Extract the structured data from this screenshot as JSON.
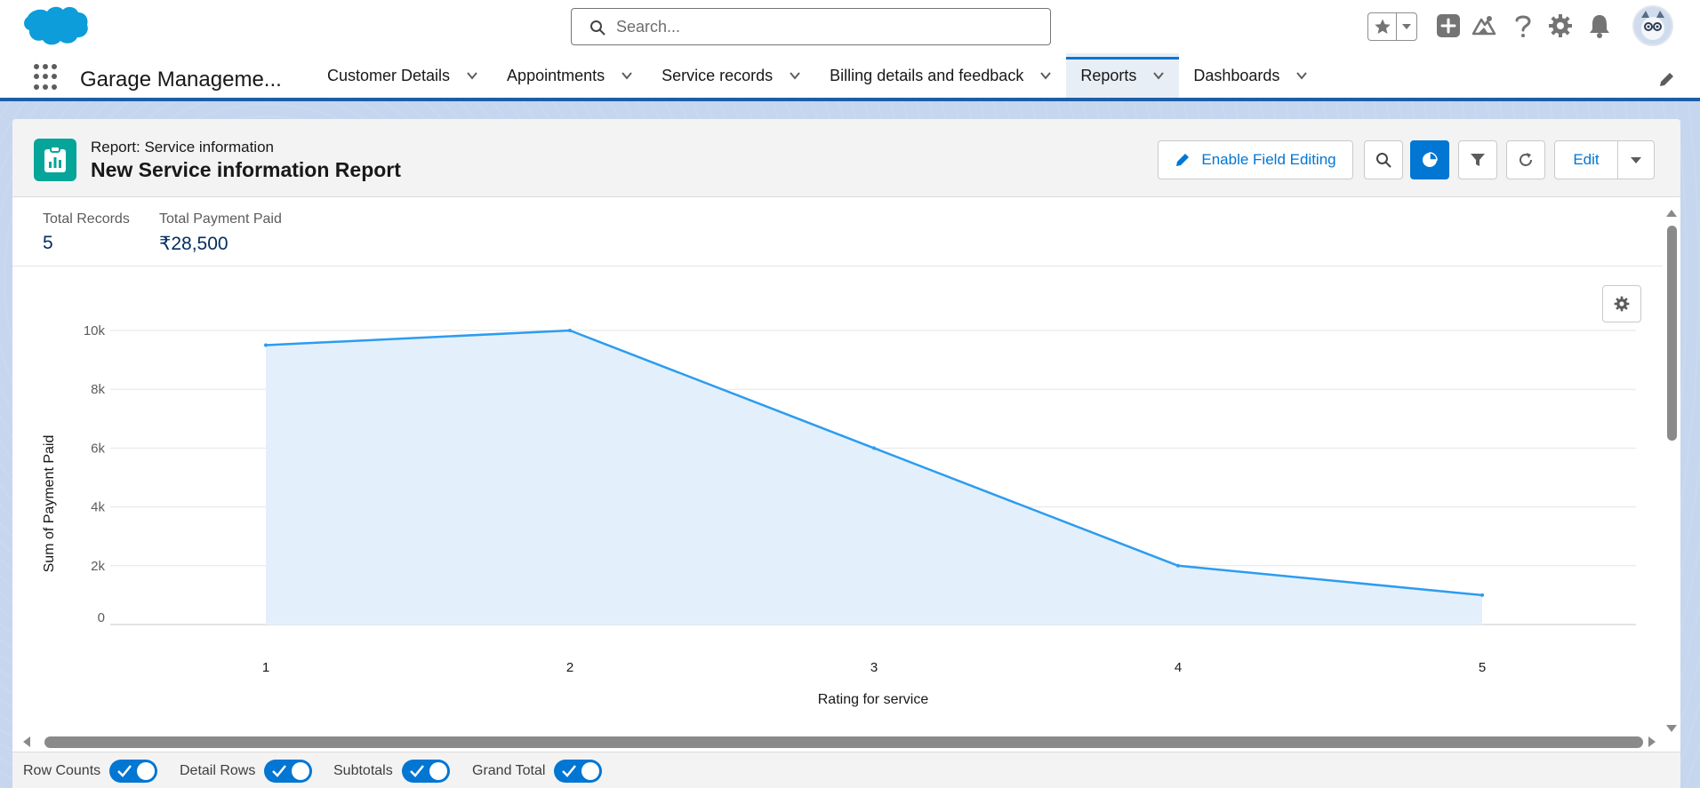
{
  "header": {
    "search_placeholder": "Search...",
    "icons": [
      "salesforce-cloud-logo",
      "search-icon",
      "star-icon",
      "chevron-down-icon",
      "plus-icon",
      "trailhead-icon",
      "help-icon",
      "gear-icon",
      "bell-icon",
      "avatar"
    ]
  },
  "nav": {
    "app_name": "Garage Manageme...",
    "tabs": [
      {
        "label": "Customer Details",
        "active": false
      },
      {
        "label": "Appointments",
        "active": false
      },
      {
        "label": "Service records",
        "active": false
      },
      {
        "label": "Billing details and feedback",
        "active": false
      },
      {
        "label": "Reports",
        "active": true
      },
      {
        "label": "Dashboards",
        "active": false
      }
    ]
  },
  "report": {
    "kicker": "Report: Service information",
    "title": "New Service information Report",
    "buttons": {
      "enable_field_editing": "Enable Field Editing",
      "edit": "Edit"
    },
    "summary": {
      "total_records_label": "Total Records",
      "total_records_value": "5",
      "total_payment_label": "Total Payment Paid",
      "total_payment_value": "₹28,500"
    }
  },
  "chart_data": {
    "type": "area",
    "x": [
      1,
      2,
      3,
      4,
      5
    ],
    "values": [
      9500,
      10000,
      6000,
      2000,
      1000
    ],
    "xlabel": "Rating for service",
    "ylabel": "Sum of Payment Paid",
    "ylim": [
      0,
      10000
    ],
    "yticks": [
      0,
      2000,
      4000,
      6000,
      8000,
      10000
    ],
    "ytick_labels": [
      "0",
      "2k",
      "4k",
      "6k",
      "8k",
      "10k"
    ],
    "xtick_labels": [
      "1",
      "2",
      "3",
      "4",
      "5"
    ],
    "grid": true,
    "line_color": "#2d9cf0",
    "fill_color": "#e3f0fc"
  },
  "footer": {
    "toggles": [
      {
        "label": "Row Counts",
        "on": true
      },
      {
        "label": "Detail Rows",
        "on": true
      },
      {
        "label": "Subtotals",
        "on": true
      },
      {
        "label": "Grand Total",
        "on": true
      }
    ]
  },
  "colors": {
    "brand": "#0176d3",
    "report_icon": "#06a59a",
    "nav_border": "#1b5fa8"
  }
}
